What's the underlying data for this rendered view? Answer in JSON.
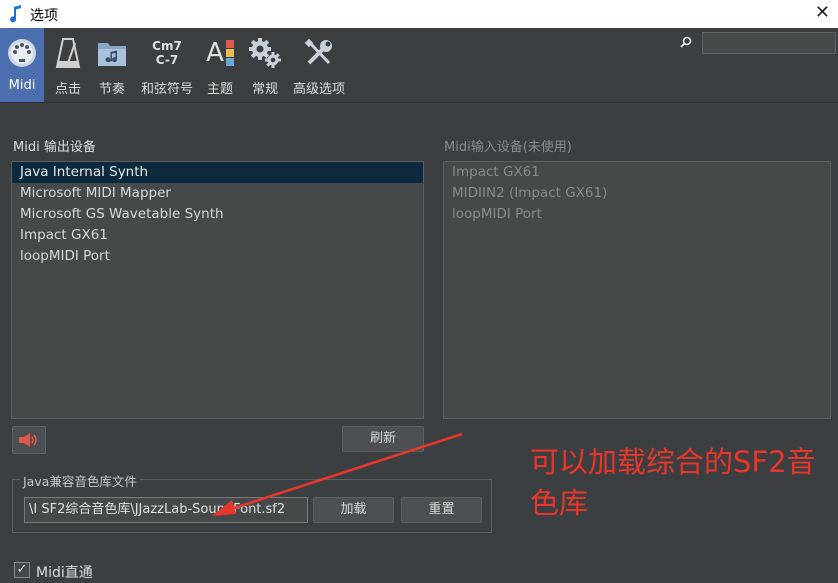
{
  "window": {
    "title": "选项",
    "close_glyph": "✕"
  },
  "toolbar": {
    "items": [
      {
        "label": "Midi",
        "icon": "midi-port-icon",
        "active": true
      },
      {
        "label": "点击",
        "icon": "metronome-icon"
      },
      {
        "label": "节奏",
        "icon": "music-folder-icon"
      },
      {
        "label": "和弦符号",
        "icon": "chord-symbol-icon",
        "icon_text_top": "Cm7",
        "icon_text_bottom": "C-7"
      },
      {
        "label": "主题",
        "icon": "theme-icon",
        "icon_text": "A"
      },
      {
        "label": "常规",
        "icon": "gears-icon"
      },
      {
        "label": "高级选项",
        "icon": "tools-icon"
      }
    ],
    "search": {
      "icon": "search-icon",
      "value": ""
    }
  },
  "midi_out": {
    "label": "Midi 输出设备",
    "items": [
      "Java Internal Synth",
      "Microsoft MIDI Mapper",
      "Microsoft GS Wavetable Synth",
      "Impact GX61",
      "loopMIDI Port"
    ],
    "selected_index": 0
  },
  "midi_in": {
    "label": "Midi输入设备(未使用)",
    "items": [
      "Impact GX61",
      "MIDIIN2 (Impact GX61)",
      "loopMIDI Port"
    ]
  },
  "buttons": {
    "speaker_icon": "speaker-icon",
    "refresh": "刷新",
    "load": "加载",
    "reset": "重置"
  },
  "soundbank": {
    "title": "Java兼容音色库文件",
    "path": "\\I SF2综合音色库\\JJazzLab-SoundFont.sf2"
  },
  "midi_thru": {
    "label": "Midi直通",
    "checked": true,
    "check_glyph": "✓"
  },
  "annotation": {
    "text": "可以加载综合的SF2音色库",
    "color": "#e8372a"
  },
  "colors": {
    "accent": "#4b6eaf",
    "selection": "#0d293e",
    "annotation": "#e8372a"
  }
}
